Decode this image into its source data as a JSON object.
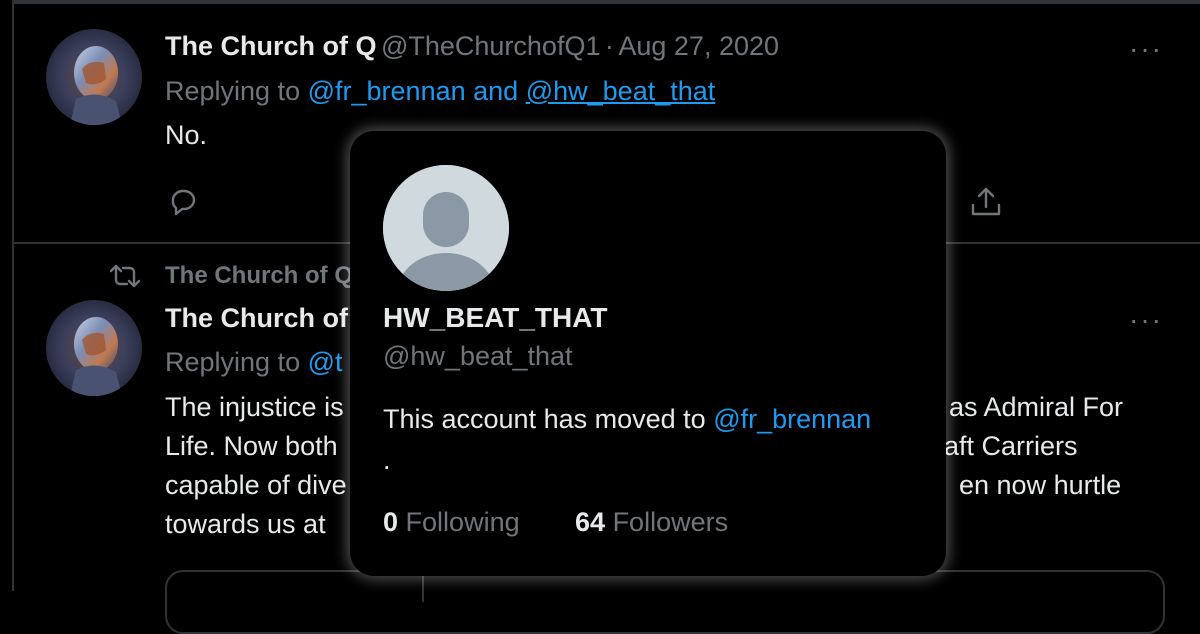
{
  "tweet1": {
    "display_name": "The Church of Q",
    "handle": "@TheChurchofQ1",
    "separator": "·",
    "date": "Aug 27, 2020",
    "replying_prefix": "Replying to",
    "reply_mention_1": "@fr_brennan",
    "reply_and": "and",
    "reply_mention_2": "@hw_beat_that",
    "text": "No.",
    "more_label": "···"
  },
  "retweet_bar": {
    "label": "The Church of Q"
  },
  "tweet2": {
    "display_name": "The Church of",
    "replying_prefix": "Replying to",
    "reply_mention_partial": "@t",
    "more_label": "···",
    "lines_left": [
      "The injustice is",
      "Life. Now both",
      "capable of dive",
      "towards us at"
    ],
    "lines_right": [
      "as Admiral For",
      "aft Carriers",
      "en now hurtle"
    ]
  },
  "hover_card": {
    "display_name": "HW_BEAT_THAT",
    "handle": "@hw_beat_that",
    "bio_prefix": "This account has moved to",
    "bio_mention": "@fr_brennan",
    "bio_suffix": ".",
    "following_count": "0",
    "following_label": "Following",
    "followers_count": "64",
    "followers_label": "Followers"
  },
  "colors": {
    "background": "#000000",
    "link": "#1d9bf0",
    "secondary_text": "#71767b",
    "primary_text": "#e7e9ea",
    "divider": "#2f3336",
    "default_avatar_bg": "#cfd9de",
    "default_avatar_fg": "#8b98a5"
  },
  "icons": {
    "reply": "reply-icon",
    "share": "share-icon",
    "retweet": "retweet-icon",
    "more": "more-icon",
    "default_avatar": "default-avatar-icon"
  }
}
